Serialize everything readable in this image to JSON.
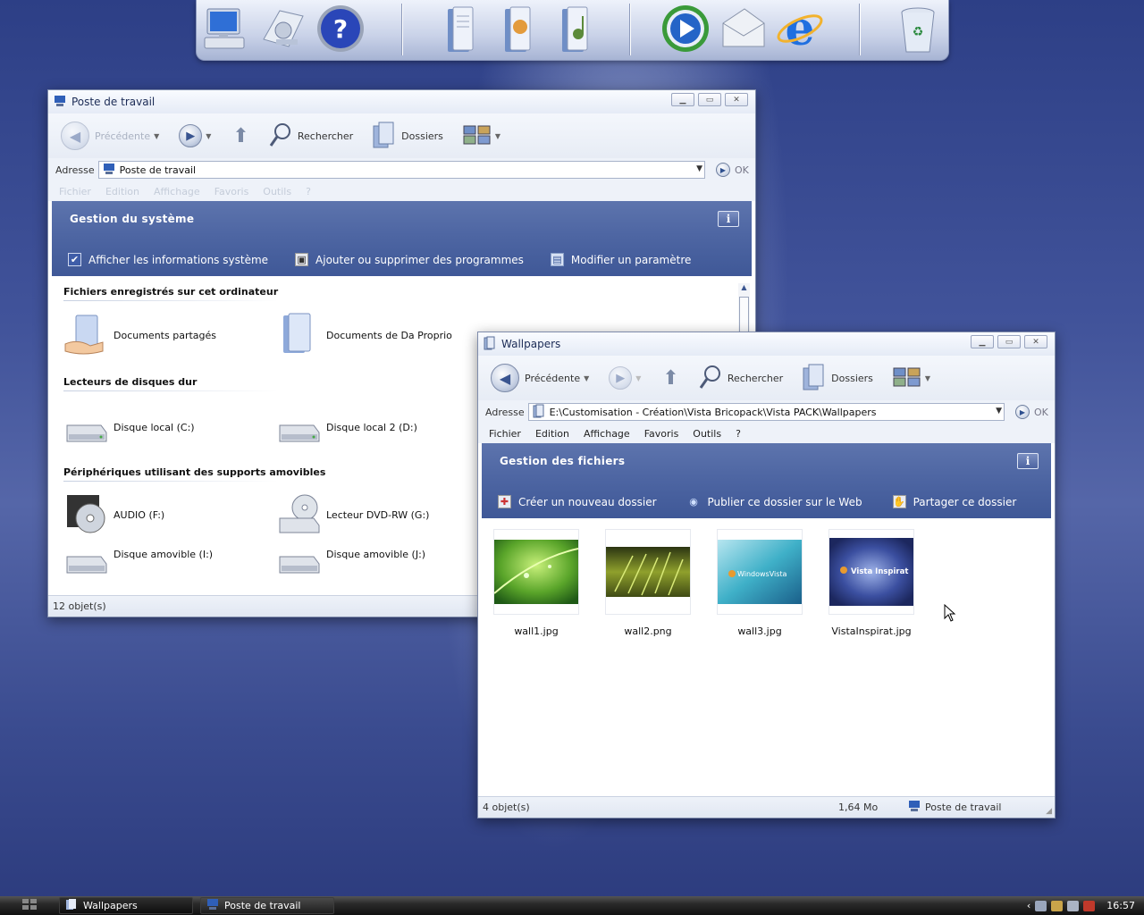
{
  "dock": {
    "icons": [
      "computer-icon",
      "network-icon",
      "help-icon",
      "documents-icon",
      "pictures-icon",
      "music-icon",
      "media-player-icon",
      "mail-icon",
      "internet-explorer-icon",
      "recycle-bin-icon"
    ]
  },
  "window_poste": {
    "title": "Poste de travail",
    "toolbar": {
      "back_label": "Précédente",
      "search_label": "Rechercher",
      "folders_label": "Dossiers"
    },
    "address": {
      "label": "Adresse",
      "value": "Poste de travail",
      "ok_label": "OK"
    },
    "menu": [
      "Fichier",
      "Edition",
      "Affichage",
      "Favoris",
      "Outils",
      "?"
    ],
    "taskpane": {
      "title": "Gestion du système",
      "links": [
        "Afficher les informations système",
        "Ajouter ou supprimer des programmes",
        "Modifier un paramètre"
      ]
    },
    "sections": {
      "files_title": "Fichiers enregistrés sur cet ordinateur",
      "files": [
        "Documents partagés",
        "Documents de Da Proprio"
      ],
      "drives_title": "Lecteurs de disques dur",
      "drives": [
        "Disque local (C:)",
        "Disque local 2 (D:)"
      ],
      "removable_title": "Périphériques utilisant des supports amovibles",
      "removable": [
        "AUDIO (F:)",
        "Lecteur DVD-RW (G:)",
        "Disque amovible (I:)",
        "Disque amovible (J:)"
      ]
    },
    "status": "12 objet(s)"
  },
  "window_wall": {
    "title": "Wallpapers",
    "toolbar": {
      "back_label": "Précédente",
      "search_label": "Rechercher",
      "folders_label": "Dossiers"
    },
    "address": {
      "label": "Adresse",
      "value": "E:\\Customisation - Création\\Vista Bricopack\\Vista PACK\\Wallpapers",
      "ok_label": "OK"
    },
    "menu": [
      "Fichier",
      "Edition",
      "Affichage",
      "Favoris",
      "Outils",
      "?"
    ],
    "taskpane": {
      "title": "Gestion des fichiers",
      "links": [
        "Créer un nouveau dossier",
        "Publier ce dossier sur le Web",
        "Partager ce dossier"
      ]
    },
    "files": [
      {
        "name": "wall1.jpg"
      },
      {
        "name": "wall2.png"
      },
      {
        "name": "wall3.jpg",
        "overlay": "WindowsVista"
      },
      {
        "name": "VistaInspirat.jpg",
        "overlay": "Vista Inspirat"
      }
    ],
    "status": {
      "count": "4 objet(s)",
      "size": "1,64 Mo",
      "location": "Poste de travail"
    }
  },
  "taskbar": {
    "tasks": [
      "Wallpapers",
      "Poste de travail"
    ],
    "clock": "16:57"
  }
}
